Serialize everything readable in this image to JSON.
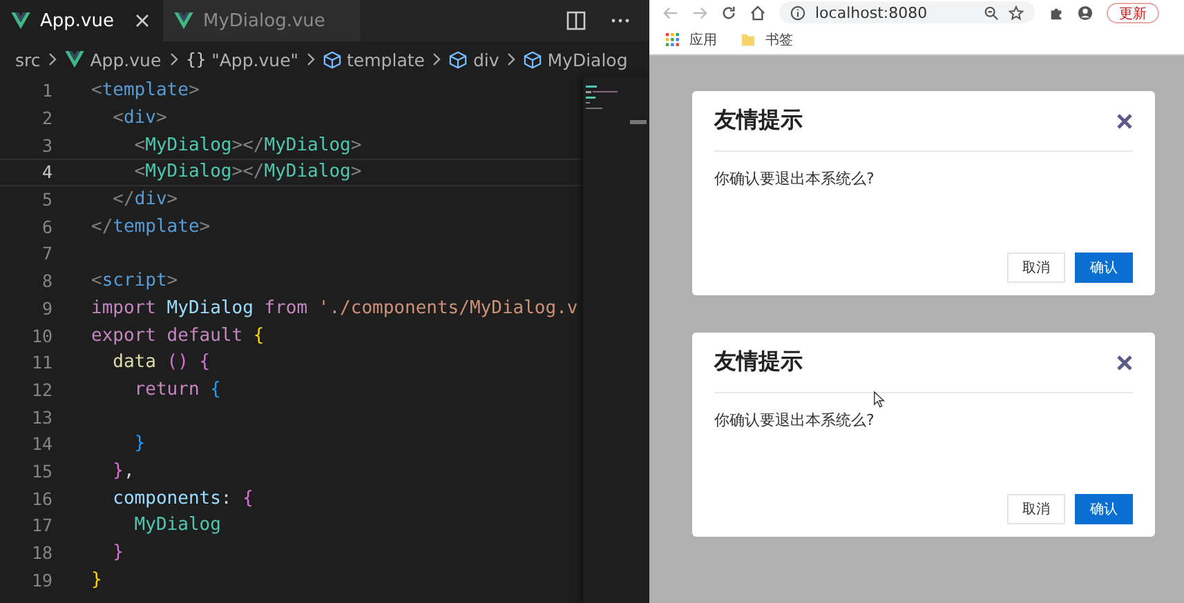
{
  "editor": {
    "tabs": [
      {
        "label": "App.vue",
        "selected": true
      },
      {
        "label": "MyDialog.vue",
        "selected": false
      }
    ],
    "breadcrumbs": [
      {
        "kind": "folder",
        "label": "src"
      },
      {
        "kind": "vue",
        "label": "App.vue"
      },
      {
        "kind": "object",
        "symbol": "{}",
        "label": "\"App.vue\""
      },
      {
        "kind": "element",
        "label": "template"
      },
      {
        "kind": "element",
        "label": "div"
      },
      {
        "kind": "element",
        "label": "MyDialog"
      }
    ],
    "lines": [
      {
        "number": "1",
        "current": false,
        "tokens": [
          {
            "kind": "punct",
            "text": "<"
          },
          {
            "kind": "tag",
            "text": "template"
          },
          {
            "kind": "punct",
            "text": ">"
          }
        ]
      },
      {
        "number": "2",
        "current": false,
        "tokens": [
          {
            "kind": "punct",
            "text": "  <"
          },
          {
            "kind": "tag",
            "text": "div"
          },
          {
            "kind": "punct",
            "text": ">"
          }
        ]
      },
      {
        "number": "3",
        "current": false,
        "tokens": [
          {
            "kind": "punct",
            "text": "    <"
          },
          {
            "kind": "component",
            "text": "MyDialog"
          },
          {
            "kind": "punct",
            "text": "></"
          },
          {
            "kind": "component",
            "text": "MyDialog"
          },
          {
            "kind": "punct",
            "text": ">"
          }
        ]
      },
      {
        "number": "4",
        "current": true,
        "tokens": [
          {
            "kind": "punct",
            "text": "    <"
          },
          {
            "kind": "component",
            "text": "MyDialog"
          },
          {
            "kind": "punct",
            "text": "></"
          },
          {
            "kind": "component",
            "text": "MyDialog"
          },
          {
            "kind": "punct",
            "text": ">"
          }
        ]
      },
      {
        "number": "5",
        "current": false,
        "tokens": [
          {
            "kind": "punct",
            "text": "  </"
          },
          {
            "kind": "tag",
            "text": "div"
          },
          {
            "kind": "punct",
            "text": ">"
          }
        ]
      },
      {
        "number": "6",
        "current": false,
        "tokens": [
          {
            "kind": "punct",
            "text": "</"
          },
          {
            "kind": "tag",
            "text": "template"
          },
          {
            "kind": "punct",
            "text": ">"
          }
        ]
      },
      {
        "number": "7",
        "current": false
      },
      {
        "number": "8",
        "current": false,
        "tokens": [
          {
            "kind": "punct",
            "text": "<"
          },
          {
            "kind": "tag",
            "text": "script"
          },
          {
            "kind": "punct",
            "text": ">"
          }
        ]
      },
      {
        "number": "9",
        "current": false,
        "tokens": [
          {
            "kind": "keyword",
            "text": "import"
          },
          {
            "kind": "variable",
            "text": " MyDialog "
          },
          {
            "kind": "keyword",
            "text": "from"
          },
          {
            "kind": "string",
            "text": " './components/MyDialog.v"
          }
        ]
      },
      {
        "number": "10",
        "current": false,
        "tokens": [
          {
            "kind": "keyword",
            "text": "export default"
          },
          {
            "kind": "bracket1",
            "text": " {"
          }
        ]
      },
      {
        "number": "11",
        "current": false,
        "tokens": [
          {
            "kind": "function",
            "text": "  data"
          },
          {
            "kind": "bracket2",
            "text": " () {"
          }
        ]
      },
      {
        "number": "12",
        "current": false,
        "tokens": [
          {
            "kind": "keyword",
            "text": "    return"
          },
          {
            "kind": "bracket3",
            "text": " {"
          }
        ]
      },
      {
        "number": "13",
        "current": false
      },
      {
        "number": "14",
        "current": false,
        "tokens": [
          {
            "kind": "bracket3",
            "text": "    }"
          }
        ]
      },
      {
        "number": "15",
        "current": false,
        "tokens": [
          {
            "kind": "bracket2",
            "text": "  }"
          },
          {
            "kind": "plain",
            "text": ","
          }
        ]
      },
      {
        "number": "16",
        "current": false,
        "tokens": [
          {
            "kind": "variable",
            "text": "  components"
          },
          {
            "kind": "plain",
            "text": ": "
          },
          {
            "kind": "bracket2",
            "text": "{"
          }
        ]
      },
      {
        "number": "17",
        "current": false,
        "tokens": [
          {
            "kind": "component",
            "text": "    MyDialog"
          }
        ]
      },
      {
        "number": "18",
        "current": false,
        "tokens": [
          {
            "kind": "bracket2",
            "text": "  }"
          }
        ]
      },
      {
        "number": "19",
        "current": false,
        "tokens": [
          {
            "kind": "bracket1",
            "text": "}"
          }
        ]
      }
    ]
  },
  "browser": {
    "url": "localhost:8080",
    "update_button": "更新",
    "bookmarks": [
      {
        "kind": "apps",
        "label": "应用"
      },
      {
        "kind": "folder",
        "label": "书签"
      }
    ],
    "dialogs": [
      {
        "title": "友情提示",
        "message": "你确认要退出本系统么?",
        "pointer": false,
        "buttons": [
          {
            "kind": "secondary",
            "label": "取消"
          },
          {
            "kind": "primary",
            "label": "确认"
          }
        ]
      },
      {
        "title": "友情提示",
        "message": "你确认要退出本系统么?",
        "pointer": true,
        "buttons": [
          {
            "kind": "secondary",
            "label": "取消"
          },
          {
            "kind": "primary",
            "label": "确认"
          }
        ]
      }
    ]
  }
}
